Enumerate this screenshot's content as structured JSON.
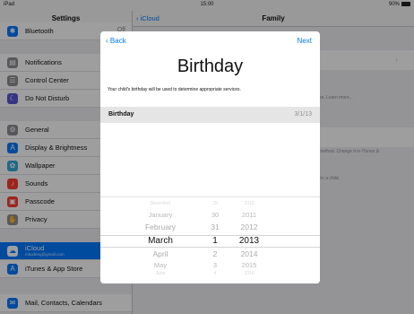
{
  "status_bar": {
    "device": "iPad",
    "time": "15:00",
    "battery": "90%"
  },
  "settings": {
    "title": "Settings",
    "items": [
      {
        "label": "Bluetooth",
        "value": "Off",
        "icon": "bluetooth-icon",
        "icon_color": "#007aff"
      },
      {
        "label": "Notifications",
        "icon": "notifications-icon",
        "icon_color": "#8e8e93"
      },
      {
        "label": "Control Center",
        "icon": "control-center-icon",
        "icon_color": "#8e8e93"
      },
      {
        "label": "Do Not Disturb",
        "icon": "moon-icon",
        "icon_color": "#5856d6"
      },
      {
        "label": "General",
        "icon": "gear-icon",
        "icon_color": "#8e8e93"
      },
      {
        "label": "Display & Brightness",
        "icon": "brightness-icon",
        "icon_color": "#007aff"
      },
      {
        "label": "Wallpaper",
        "icon": "wallpaper-icon",
        "icon_color": "#34aadc"
      },
      {
        "label": "Sounds",
        "icon": "sounds-icon",
        "icon_color": "#ff3b30"
      },
      {
        "label": "Passcode",
        "icon": "lock-icon",
        "icon_color": "#ff3b30"
      },
      {
        "label": "Privacy",
        "icon": "hand-icon",
        "icon_color": "#8e8e93"
      },
      {
        "label": "iCloud",
        "sublabel": "mkudeng@gmail.com",
        "icon": "icloud-icon",
        "icon_color": "#ffffff"
      },
      {
        "label": "iTunes & App Store",
        "icon": "app-store-icon",
        "icon_color": "#007aff"
      },
      {
        "label": "Mail, Contacts, Calendars",
        "icon": "mail-icon",
        "icon_color": "#007aff"
      }
    ]
  },
  "detail": {
    "back_label": "iCloud",
    "title": "Family",
    "learn_more_fragment": "se. Learn more...",
    "change_fragment": "method. Change it in iTunes &",
    "child_fragment": "for a child."
  },
  "modal": {
    "back_label": "Back",
    "next_label": "Next",
    "title": "Birthday",
    "description": "Your child's birthday will be used to determine appropriate services.",
    "field_label": "Birthday",
    "field_value": "3/1/13"
  },
  "picker": {
    "months": [
      "December",
      "January",
      "February",
      "March",
      "April",
      "May",
      "June"
    ],
    "days": [
      "29",
      "30",
      "31",
      "1",
      "2",
      "3",
      "4"
    ],
    "years": [
      "2010",
      "2011",
      "2012",
      "2013",
      "2014",
      "2015",
      "2016"
    ],
    "selected": {
      "month": "March",
      "day": "1",
      "year": "2013"
    }
  },
  "colors": {
    "accent": "#007aff",
    "selection": "#007aff"
  }
}
